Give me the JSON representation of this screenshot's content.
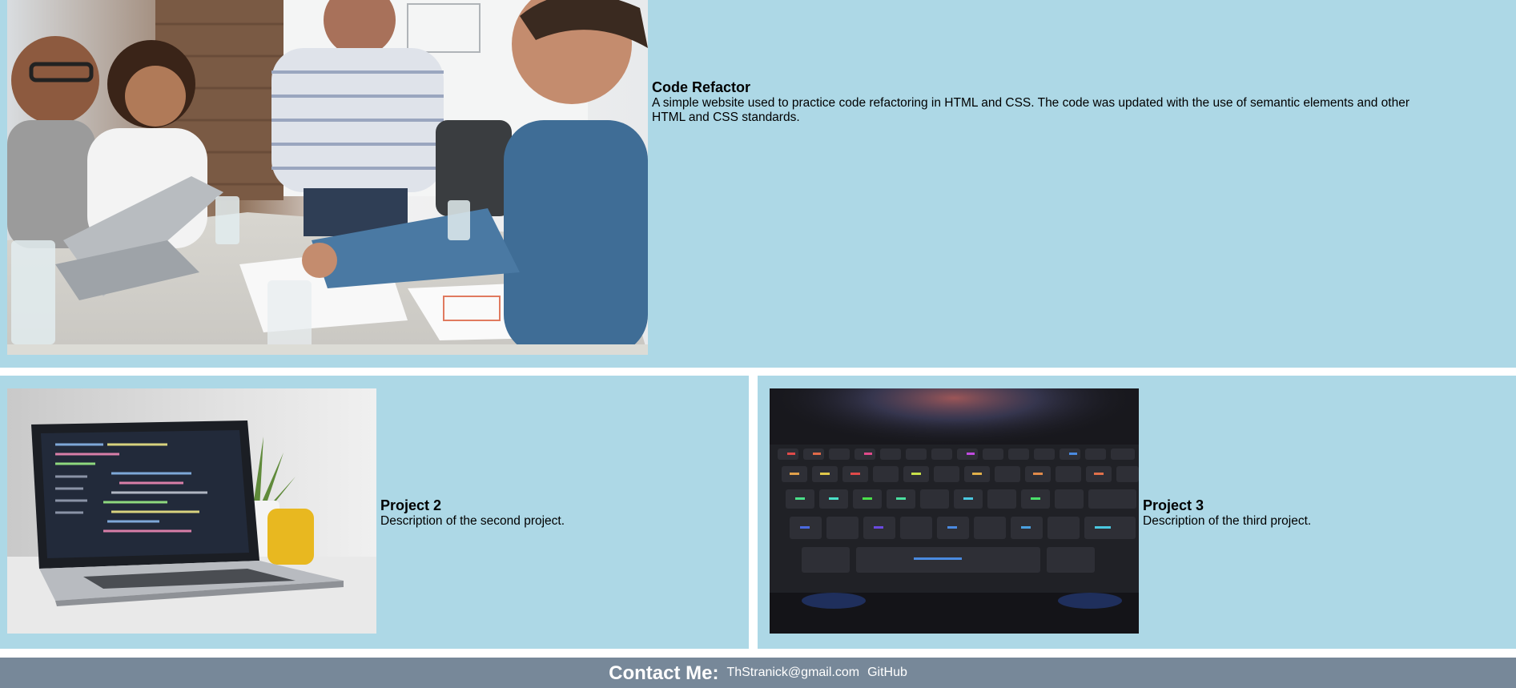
{
  "colors": {
    "card_background": "#add8e6",
    "footer_background": "#778899",
    "footer_text": "#ffffff",
    "page_background": "#ffffff"
  },
  "projects": [
    {
      "title": "Code Refactor",
      "description": "A simple website used to practice code refactoring in HTML and CSS. The code was updated with the use of semantic elements and other HTML and CSS standards.",
      "image": "team-meeting-photo"
    },
    {
      "title": "Project 2",
      "description": "Description of the second project.",
      "image": "laptop-code-photo"
    },
    {
      "title": "Project 3",
      "description": "Description of the third project.",
      "image": "rgb-keyboard-photo"
    }
  ],
  "footer": {
    "heading": "Contact Me:",
    "email": "ThStranick@gmail.com",
    "github": "GitHub"
  }
}
